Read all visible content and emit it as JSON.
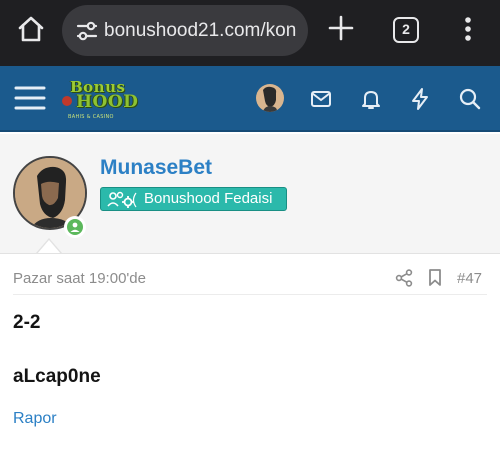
{
  "browser": {
    "url": "bonushood21.com/kon",
    "tab_count": "2",
    "colors": {
      "bar": "#1f1f22",
      "url_field": "#3a3a3e"
    }
  },
  "site": {
    "logo": {
      "line1": "Bonus",
      "line2": "HOOD",
      "tagline": "BAHIS & CASINO"
    },
    "header_color": "#1b5a8d",
    "icons": [
      "menu-icon",
      "avatar",
      "envelope-icon",
      "bell-icon",
      "bolt-icon",
      "search-icon"
    ]
  },
  "post": {
    "author": "MunaseBet",
    "rank": "Bonushood Fedaisi",
    "rank_color": "#2bb9ab",
    "online_color": "#5cb85c",
    "date": "Pazar saat 19:00'de",
    "number": "#47",
    "body": [
      "2-2",
      "aLcap0ne"
    ],
    "report_label": "Rapor"
  }
}
